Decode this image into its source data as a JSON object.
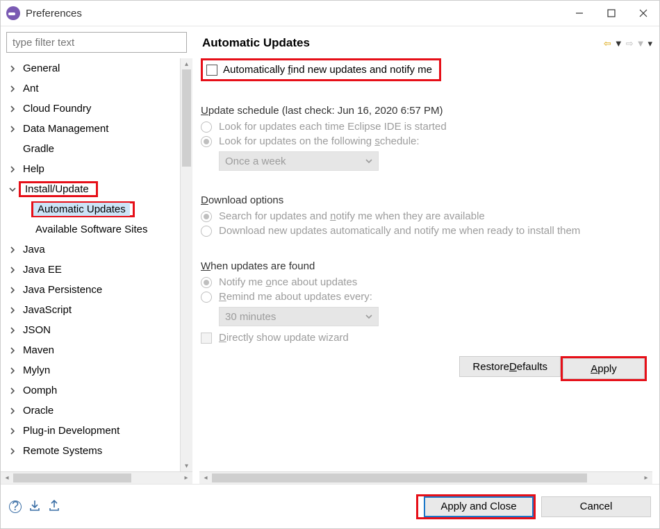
{
  "titlebar": {
    "title": "Preferences"
  },
  "filter": {
    "placeholder": "type filter text"
  },
  "tree": {
    "items": [
      {
        "label": "General"
      },
      {
        "label": "Ant"
      },
      {
        "label": "Cloud Foundry"
      },
      {
        "label": "Data Management"
      },
      {
        "label": "Gradle",
        "no_expander": true
      },
      {
        "label": "Help"
      },
      {
        "label": "Install/Update",
        "expanded": true,
        "highlighted": true
      },
      {
        "label": "Automatic Updates",
        "child": true,
        "selected": true,
        "highlighted": true
      },
      {
        "label": "Available Software Sites",
        "child": true
      },
      {
        "label": "Java"
      },
      {
        "label": "Java EE"
      },
      {
        "label": "Java Persistence"
      },
      {
        "label": "JavaScript"
      },
      {
        "label": "JSON"
      },
      {
        "label": "Maven"
      },
      {
        "label": "Mylyn"
      },
      {
        "label": "Oomph"
      },
      {
        "label": "Oracle"
      },
      {
        "label": "Plug-in Development"
      },
      {
        "label": "Remote Systems"
      }
    ]
  },
  "main": {
    "title": "Automatic Updates",
    "auto_find_pre": "Automatically ",
    "auto_find_u": "f",
    "auto_find_post": "ind new updates and notify me",
    "schedule_title_u": "U",
    "schedule_title_post": "pdate schedule (last check: Jun 16, 2020 6:57 PM)",
    "schedule_opt1": "Look for updates each time Eclipse IDE is started",
    "schedule_opt2_pre": "Look for updates on the following ",
    "schedule_opt2_u": "s",
    "schedule_opt2_post": "chedule:",
    "schedule_combo": "Once a week",
    "download_title_u": "D",
    "download_title_post": "ownload options",
    "download_opt1_pre": "Search for updates and ",
    "download_opt1_u": "n",
    "download_opt1_post": "otify me when they are available",
    "download_opt2": "Download new updates automatically and notify me when ready to install them",
    "found_title_u": "W",
    "found_title_post": "hen updates are found",
    "found_opt1_pre": "Notify me ",
    "found_opt1_u": "o",
    "found_opt1_post": "nce about updates",
    "found_opt2_u": "R",
    "found_opt2_post": "emind me about updates every:",
    "found_combo": "30 minutes",
    "direct_u": "D",
    "direct_post": "irectly show update wizard",
    "restore_pre": "Restore ",
    "restore_u": "D",
    "restore_post": "efaults",
    "apply_u": "A",
    "apply_post": "pply"
  },
  "bottom": {
    "apply_close": "Apply and Close",
    "cancel": "Cancel"
  }
}
